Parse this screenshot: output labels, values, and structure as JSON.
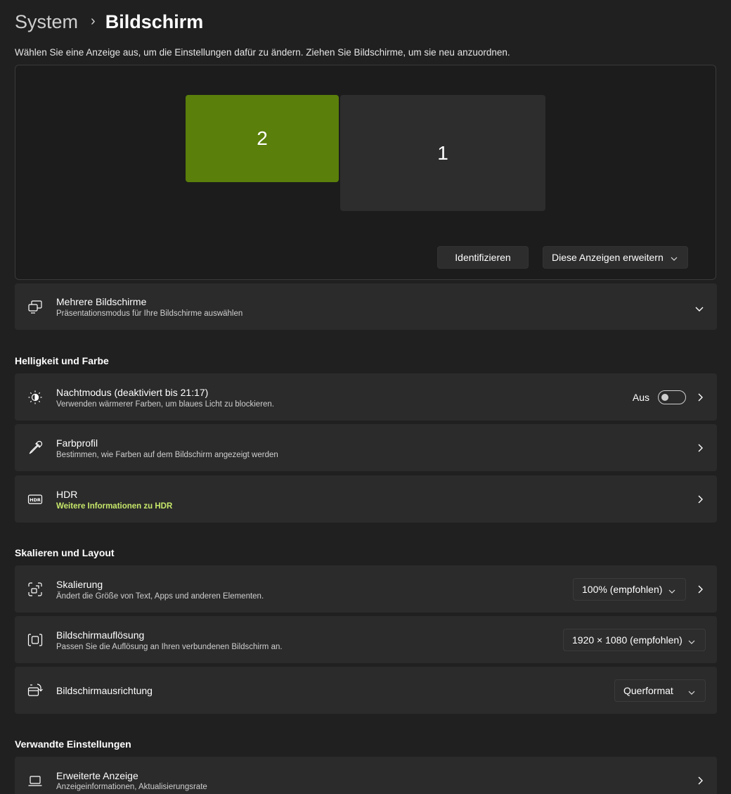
{
  "breadcrumb": {
    "parent": "System",
    "separator": "›",
    "current": "Bildschirm"
  },
  "intro": "Wählen Sie eine Anzeige aus, um die Einstellungen dafür zu ändern. Ziehen Sie Bildschirme, um sie neu anzuordnen.",
  "display_panel": {
    "monitors": [
      {
        "label": "2",
        "selected": true,
        "color": "#5a7f0a"
      },
      {
        "label": "1",
        "selected": false,
        "color": "#2d2d2d"
      }
    ],
    "identify_label": "Identifizieren",
    "mode_select": "Diese Anzeigen erweitern"
  },
  "multi_display": {
    "title": "Mehrere Bildschirme",
    "subtitle": "Präsentationsmodus für Ihre Bildschirme auswählen",
    "icon": "multi-monitor-icon"
  },
  "sections": {
    "brightness": "Helligkeit und Farbe",
    "scale": "Skalieren und Layout",
    "related": "Verwandte Einstellungen"
  },
  "night_mode": {
    "title": "Nachtmodus (deaktiviert bis 21:17)",
    "subtitle": "Verwenden wärmerer Farben, um blaues Licht zu blockieren.",
    "toggle_label": "Aus",
    "toggle_on": false,
    "icon": "night-light-icon"
  },
  "color_profile": {
    "title": "Farbprofil",
    "subtitle": "Bestimmen, wie Farben auf dem Bildschirm angezeigt werden",
    "icon": "eyedropper-icon"
  },
  "hdr": {
    "title": "HDR",
    "subtitle": "Weitere Informationen zu HDR",
    "accent_color": "#c7e86a",
    "icon": "hdr-icon"
  },
  "scaling": {
    "title": "Skalierung",
    "subtitle": "Ändert die Größe von Text, Apps und anderen Elementen.",
    "value": "100% (empfohlen)",
    "icon": "scale-icon"
  },
  "resolution": {
    "title": "Bildschirmauflösung",
    "subtitle": "Passen Sie die Auflösung an Ihren verbundenen Bildschirm an.",
    "value": "1920 × 1080 (empfohlen)",
    "icon": "resolution-icon"
  },
  "orientation": {
    "title": "Bildschirmausrichtung",
    "value": "Querformat",
    "icon": "orientation-icon"
  },
  "advanced": {
    "title": "Erweiterte Anzeige",
    "subtitle": "Anzeigeinformationen, Aktualisierungsrate",
    "icon": "laptop-icon"
  },
  "colors": {
    "background": "#202020",
    "card": "#2b2b2b",
    "accent": "#5a7f0a"
  }
}
